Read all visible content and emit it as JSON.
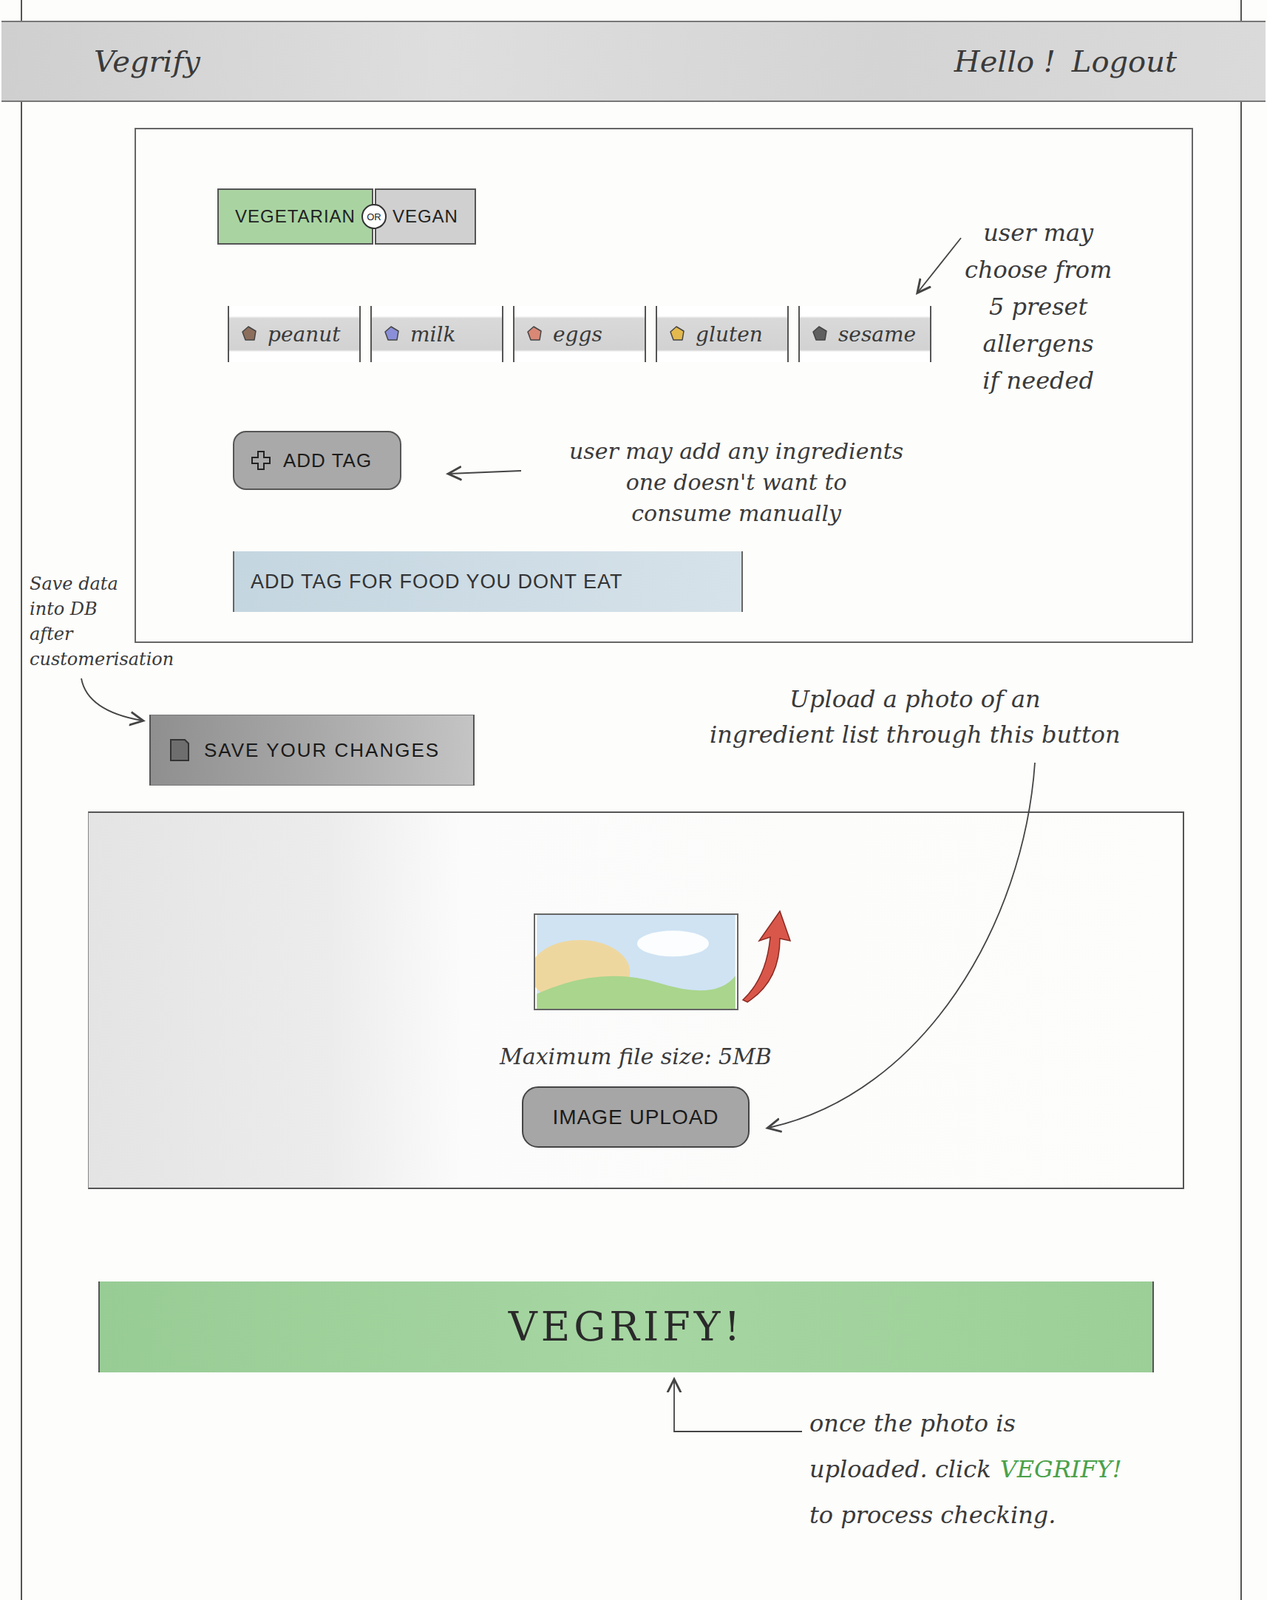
{
  "header": {
    "logo": "Vegrify",
    "greeting": "Hello !",
    "logout": "Logout"
  },
  "diet": {
    "options": [
      {
        "label": "VEGETARIAN",
        "selected": true
      },
      {
        "label": "VEGAN",
        "selected": false
      }
    ],
    "separator": "OR"
  },
  "allergens": [
    {
      "label": "peanut",
      "color": "#8c6e5c"
    },
    {
      "label": "milk",
      "color": "#8a8fd8"
    },
    {
      "label": "eggs",
      "color": "#d98876"
    },
    {
      "label": "gluten",
      "color": "#e3b94e"
    },
    {
      "label": "sesame",
      "color": "#5f5f5f"
    }
  ],
  "add_tag": {
    "label": "ADD TAG"
  },
  "tag_input": {
    "placeholder": "ADD TAG FOR FOOD YOU DONT EAT"
  },
  "save": {
    "label": "SAVE YOUR CHANGES"
  },
  "upload": {
    "note": "Maximum file size: 5MB",
    "button": "IMAGE UPLOAD"
  },
  "vegrify": {
    "label": "VEGRIFY!"
  },
  "annotations": {
    "allergens": [
      "user may",
      "choose from",
      "5 preset",
      "allergens",
      "if needed"
    ],
    "add_tag": [
      "user may add any ingredients",
      "one doesn't want to",
      "consume manually"
    ],
    "save": [
      "Save data",
      "into DB",
      "after",
      "customerisation"
    ],
    "upload": [
      "Upload a photo of an",
      "ingredient list through this button"
    ],
    "vegrify": [
      [
        {
          "text": "once the photo is",
          "highlight": false
        }
      ],
      [
        {
          "text": "uploaded. click",
          "highlight": false
        },
        {
          "text": "VEGRIFY!",
          "highlight": true
        }
      ],
      [
        {
          "text": "to process checking.",
          "highlight": false
        }
      ]
    ]
  }
}
